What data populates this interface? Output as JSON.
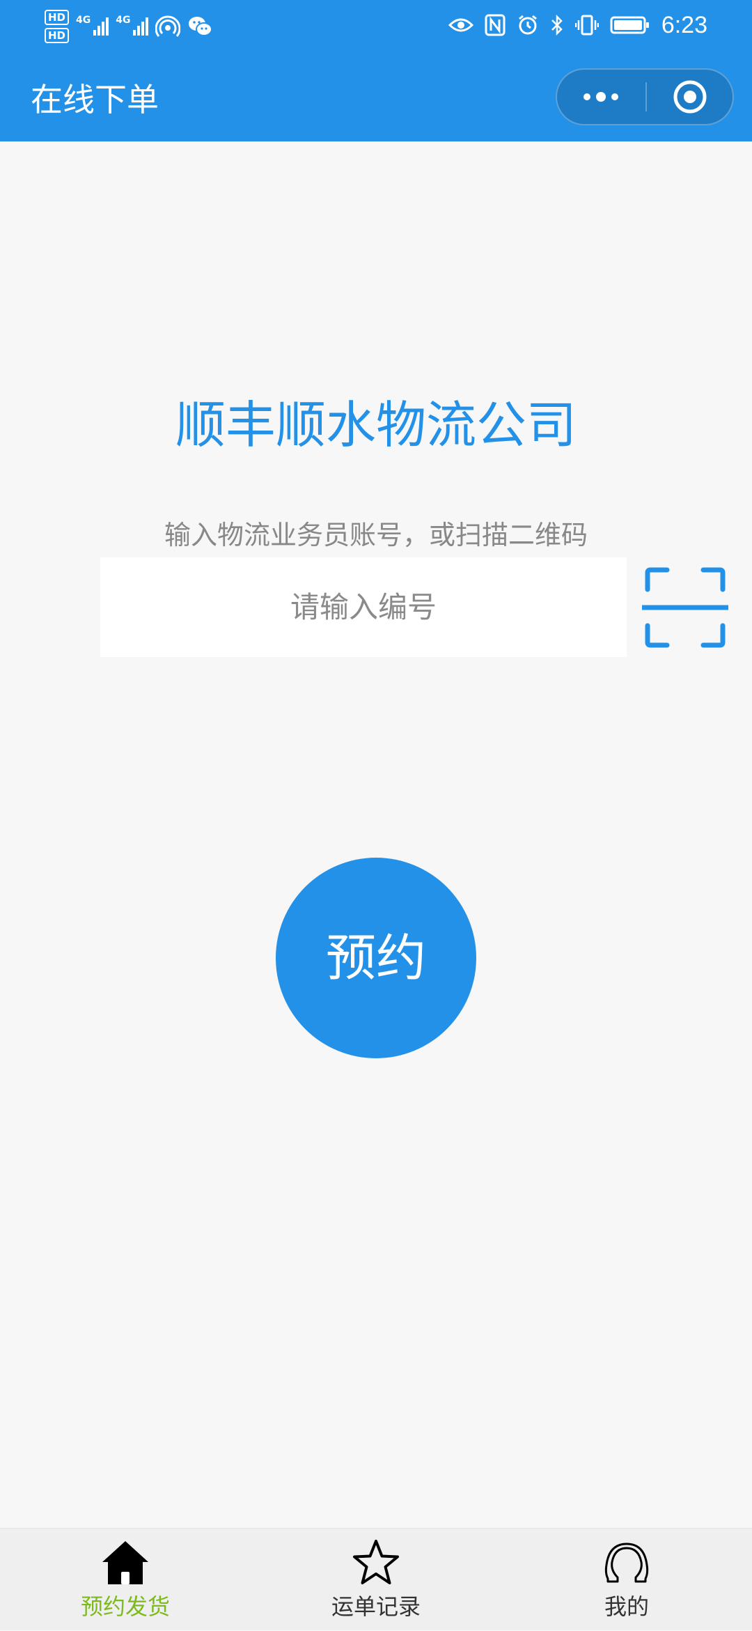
{
  "status_bar": {
    "hd1": "HD",
    "hd2": "HD",
    "sim1_type": "4G",
    "sim2_type": "4G",
    "time": "6:23"
  },
  "nav": {
    "title": "在线下单"
  },
  "main": {
    "company_name": "顺丰顺水物流公司",
    "hint": "输入物流业务员账号，或扫描二维码",
    "code_input": {
      "value": "",
      "placeholder": "请输入编号"
    },
    "reserve_label": "预约"
  },
  "tab_bar": {
    "items": [
      {
        "label": "预约发货",
        "icon": "home-icon",
        "active": true
      },
      {
        "label": "运单记录",
        "icon": "star-icon",
        "active": false
      },
      {
        "label": "我的",
        "icon": "omega-icon",
        "active": false
      }
    ]
  },
  "colors": {
    "primary": "#2491e8",
    "tab_active": "#7dba1e",
    "background": "#f7f7f7"
  }
}
